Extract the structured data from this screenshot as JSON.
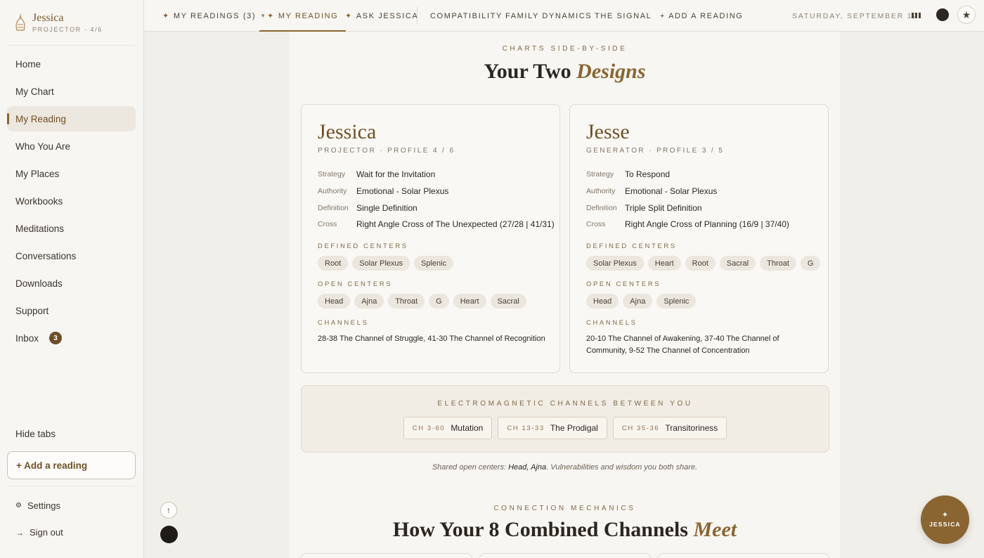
{
  "brand": {
    "name": "Jessica",
    "subtitle": "PROJECTOR · 4/6"
  },
  "sidebar": {
    "items": [
      {
        "label": "Home"
      },
      {
        "label": "My Chart"
      },
      {
        "label": "My Reading",
        "active": true
      },
      {
        "label": "Who You Are"
      },
      {
        "label": "My Places"
      },
      {
        "label": "Workbooks"
      },
      {
        "label": "Meditations"
      },
      {
        "label": "Conversations"
      },
      {
        "label": "Downloads"
      },
      {
        "label": "Support"
      },
      {
        "label": "Inbox",
        "badge": "3"
      }
    ],
    "hide_tabs": "Hide tabs",
    "add_reading": "+ Add a reading",
    "settings": "Settings",
    "signout": "Sign out"
  },
  "topbar": {
    "tabs": [
      {
        "label": "MY READINGS (3)"
      },
      {
        "label": "MY READING"
      },
      {
        "label": "ASK JESSICA"
      },
      {
        "label": "COMPATIBILITY"
      },
      {
        "label": "FAMILY DYNAMICS"
      },
      {
        "label": "THE SIGNAL"
      },
      {
        "label": "+ ADD A READING"
      }
    ],
    "date": "SATURDAY, SEPTEMBER 19"
  },
  "main": {
    "eyebrow": "CHARTS SIDE-BY-SIDE",
    "title_plain": "Your Two",
    "title_em": "Designs",
    "labels": {
      "strategy": "Strategy",
      "authority": "Authority",
      "definition": "Definition",
      "cross": "Cross",
      "defined_centers": "DEFINED CENTERS",
      "open_centers": "OPEN CENTERS",
      "channels": "CHANNELS"
    },
    "people": [
      {
        "name": "Jessica",
        "type": "PROJECTOR · PROFILE 4 / 6",
        "strategy": "Wait for the Invitation",
        "authority": "Emotional - Solar Plexus",
        "definition": "Single Definition",
        "cross": "Right Angle Cross of The Unexpected (27/28 | 41/31)",
        "defined_centers": [
          "Root",
          "Solar Plexus",
          "Splenic"
        ],
        "open_centers": [
          "Head",
          "Ajna",
          "Throat",
          "G",
          "Heart",
          "Sacral"
        ],
        "channels": "28-38 The Channel of Struggle, 41-30 The Channel of Recognition"
      },
      {
        "name": "Jesse",
        "type": "GENERATOR · PROFILE 3 / 5",
        "strategy": "To Respond",
        "authority": "Emotional - Solar Plexus",
        "definition": "Triple Split Definition",
        "cross": "Right Angle Cross of Planning (16/9 | 37/40)",
        "defined_centers": [
          "Solar Plexus",
          "Heart",
          "Root",
          "Sacral",
          "Throat",
          "G"
        ],
        "open_centers": [
          "Head",
          "Ajna",
          "Splenic"
        ],
        "channels": "20-10 The Channel of Awakening, 37-40 The Channel of Community, 9-52 The Channel of Concentration"
      }
    ],
    "em": {
      "title": "ELECTROMAGNETIC CHANNELS BETWEEN YOU",
      "chips": [
        {
          "ch": "CH 3-60",
          "name": "Mutation"
        },
        {
          "ch": "CH 13-33",
          "name": "The Prodigal"
        },
        {
          "ch": "CH 35-36",
          "name": "Transitoriness"
        }
      ]
    },
    "shared": {
      "prefix": "Shared open centers: ",
      "centers": "Head, Ajna",
      "suffix": ". Vulnerabilities and wisdom you both share."
    },
    "connection_eyebrow": "CONNECTION MECHANICS",
    "connection_title_plain": "How Your 8 Combined Channels",
    "connection_title_em": "Meet"
  },
  "fab": {
    "star": "✦",
    "label": "JESSICA"
  },
  "colors": {
    "accent": "#8a6532",
    "background": "#f1efea",
    "panel": "#f8f6f2"
  }
}
